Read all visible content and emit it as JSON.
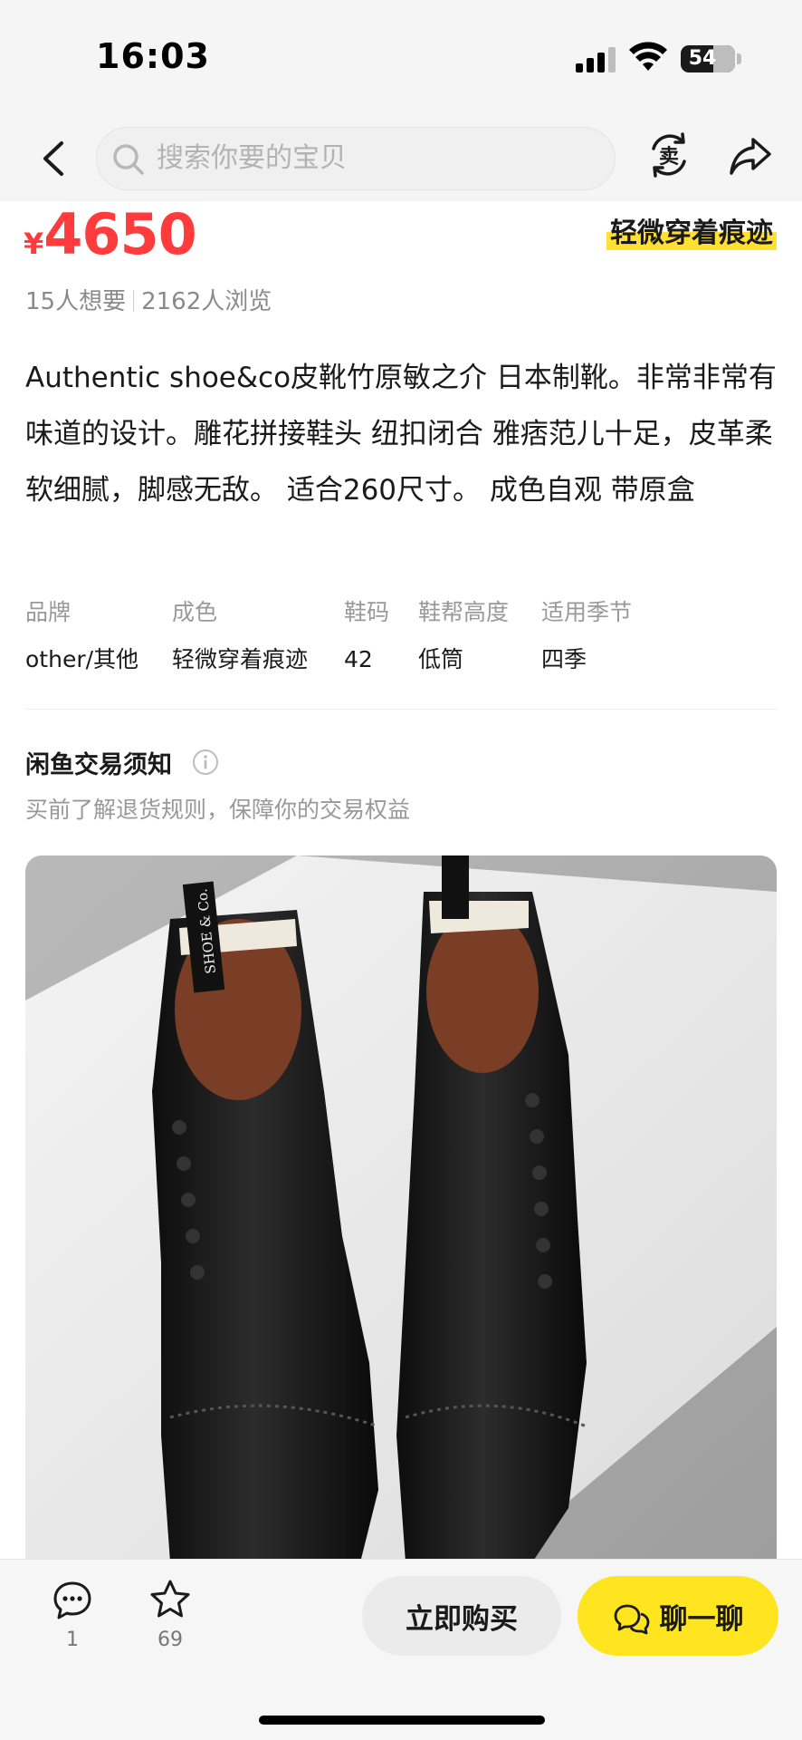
{
  "status_bar": {
    "time": "16:03",
    "battery_level": "54"
  },
  "nav": {
    "search_placeholder": "搜索你要的宝贝",
    "sell_icon_char": "卖"
  },
  "product": {
    "currency": "¥",
    "price": "4650",
    "condition_tag": "轻微穿着痕迹",
    "wants": "15人想要",
    "views": "2162人浏览",
    "description": "Authentic shoe&co皮靴竹原敏之介 日本制靴。非常非常有味道的设计。雕花拼接鞋头 纽扣闭合 雅痞范儿十足，皮革柔软细腻，脚感无敌。 适合260尺寸。 成色自观 带原盒",
    "attributes": [
      {
        "label": "品牌",
        "value": "other/其他"
      },
      {
        "label": "成色",
        "value": "轻微穿着痕迹"
      },
      {
        "label": "鞋码",
        "value": "42"
      },
      {
        "label": "鞋帮高度",
        "value": "低筒"
      },
      {
        "label": "适用季节",
        "value": "四季"
      }
    ],
    "image_label": "SHOE & Co."
  },
  "notice": {
    "title": "闲鱼交易须知",
    "subtitle": "买前了解退货规则，保障你的交易权益"
  },
  "bottom_bar": {
    "comment_count": "1",
    "favorite_count": "69",
    "buy_label": "立即购买",
    "chat_label": "聊一聊"
  },
  "colors": {
    "price": "#ff3b3b",
    "accent_yellow": "#ffe51f",
    "muted_text": "#999999"
  }
}
